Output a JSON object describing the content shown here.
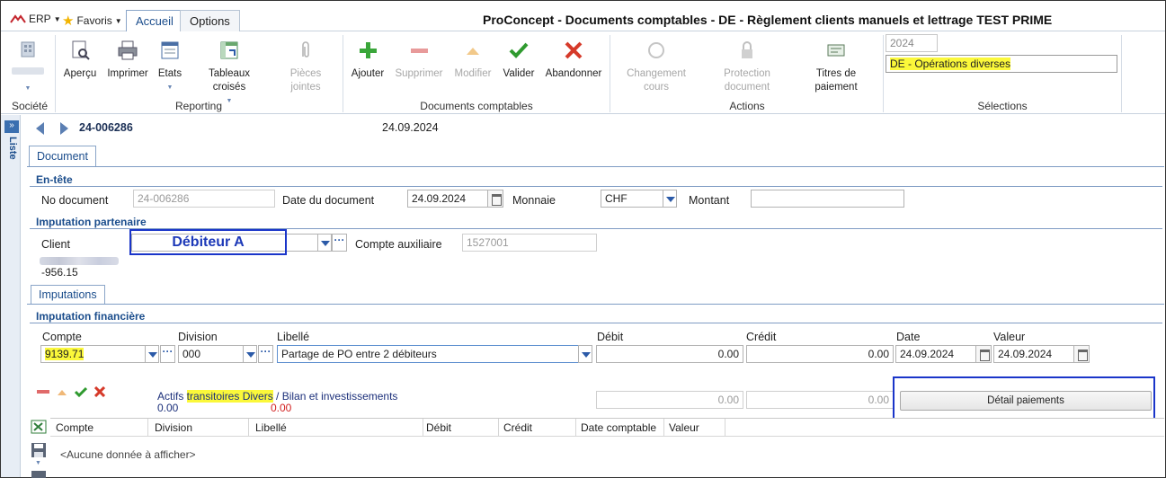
{
  "app_menu": {
    "erp_label": "ERP",
    "favoris_label": "Favoris"
  },
  "tabs": [
    {
      "label": "Accueil",
      "active": true
    },
    {
      "label": "Options",
      "active": false
    }
  ],
  "window_title": "ProConcept - Documents comptables - DE - Règlement clients manuels et lettrage TEST PRIME",
  "ribbon": {
    "groups": {
      "societe": "Société",
      "reporting": "Reporting",
      "documents": "Documents comptables",
      "actions": "Actions",
      "selections": "Sélections"
    },
    "buttons": {
      "apercu": "Aperçu",
      "imprimer": "Imprimer",
      "etats": "Etats",
      "tableaux": "Tableaux croisés",
      "pieces_l1": "Pièces",
      "pieces_l2": "jointes",
      "ajouter": "Ajouter",
      "supprimer": "Supprimer",
      "modifier": "Modifier",
      "valider": "Valider",
      "abandonner": "Abandonner",
      "changement_l1": "Changement",
      "changement_l2": "cours",
      "protection_l1": "Protection",
      "protection_l2": "document",
      "titres_l1": "Titres de",
      "titres_l2": "paiement"
    },
    "selections": {
      "year": "2024",
      "journal": "DE - Opérations diverses"
    }
  },
  "sidebar": {
    "label": "Liste",
    "toggle": "»"
  },
  "record": {
    "number": "24-006286",
    "date": "24.09.2024"
  },
  "document_tab": "Document",
  "entete": {
    "title": "En-tête",
    "no_document_label": "No document",
    "no_document_value": "24-006286",
    "date_doc_label": "Date du document",
    "date_doc_value": "24.09.2024",
    "monnaie_label": "Monnaie",
    "monnaie_value": "CHF",
    "montant_label": "Montant",
    "montant_value": ""
  },
  "imputation_partenaire": {
    "title": "Imputation partenaire",
    "client_label": "Client",
    "client_value": "Débiteur A",
    "compte_aux_label": "Compte auxiliaire",
    "compte_aux_value": "1527001",
    "solde": "-956.15"
  },
  "imputations_tab": "Imputations",
  "imputation_financiere": {
    "title": "Imputation financière",
    "labels": {
      "compte": "Compte",
      "division": "Division",
      "libelle": "Libellé",
      "debit": "Débit",
      "credit": "Crédit",
      "date": "Date",
      "valeur": "Valeur"
    },
    "values": {
      "compte": "9139.71",
      "division": "000",
      "libelle": "Partage de PO entre 2 débiteurs",
      "debit": "0.00",
      "credit": "0.00",
      "date": "24.09.2024",
      "valeur": "24.09.2024"
    },
    "account_desc_pre": "Actifs ",
    "account_desc_hl": "transitoires Divers",
    "account_desc_post": " / Bilan et investissements",
    "total_debit": "0.00",
    "total_credit": "0.00",
    "sum_debit": "0.00",
    "sum_credit": "0.00",
    "detail_button": "Détail paiements"
  },
  "grid": {
    "columns": [
      "Compte",
      "Division",
      "Libellé",
      "Débit",
      "Crédit",
      "Date comptable",
      "Valeur"
    ],
    "empty_message": "<Aucune donnée à afficher>"
  },
  "colors": {
    "accent": "#1b4d8c",
    "highlight": "#fbf83a",
    "callout": "#1a35c9"
  }
}
